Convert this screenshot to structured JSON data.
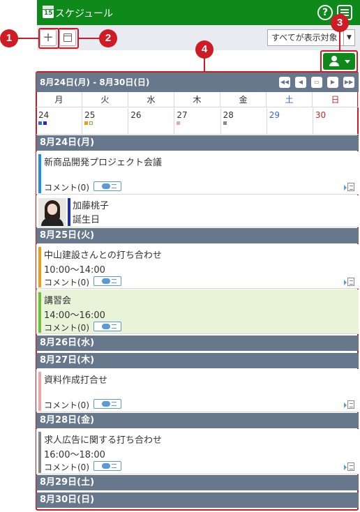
{
  "header": {
    "title": "スケジュール",
    "logo_number": "15",
    "help_label": "?"
  },
  "toolbar": {
    "add_label": "+",
    "filter_value": "すべてが表示対象",
    "filter_arrow": "▼"
  },
  "markers": [
    "1",
    "2",
    "3",
    "4"
  ],
  "calendar": {
    "range": "8月24日(月) - 8月30日(日)",
    "weekdays": [
      "月",
      "火",
      "水",
      "木",
      "金",
      "土",
      "日"
    ],
    "dates": [
      "24",
      "25",
      "26",
      "27",
      "28",
      "29",
      "30"
    ],
    "date_colors": [
      "#333333",
      "#333333",
      "#333333",
      "#333333",
      "#333333",
      "#3c63c8",
      "#c8282a"
    ],
    "day_dots": [
      [
        "#2a6edb",
        "#1a2fb5"
      ],
      [
        "#f39c12",
        "outline"
      ],
      [],
      [
        "#f4a3a3"
      ],
      [
        "#888888"
      ],
      [],
      []
    ]
  },
  "days": [
    {
      "header": "8月24日(月)"
    },
    {
      "header": "8月25日(火)"
    },
    {
      "header": "8月26日(水)"
    },
    {
      "header": "8月27日(木)"
    },
    {
      "header": "8月28日(金)"
    },
    {
      "header": "8月29日(土)"
    },
    {
      "header": "8月30日(日)"
    }
  ],
  "events": [
    {
      "title": "新商品開発プロジェクト会議",
      "time": "",
      "comment": "コメント(0)",
      "color": "#1e90e0"
    },
    {
      "title": "中山建設さんとの打ち合わせ",
      "time": "10:00～14:00",
      "comment": "コメント(0)",
      "color": "#f39c12"
    },
    {
      "title": "講習会",
      "time": "14:00～16:00",
      "comment": "コメント(0)",
      "color": "#6dbf3f"
    },
    {
      "title": "資料作成打合せ",
      "time": "",
      "comment": "コメント(0)",
      "color": "#f4a3a3"
    },
    {
      "title": "求人広告に関する打ち合わせ",
      "time": "16:00～18:00",
      "comment": "コメント(0)",
      "color": "#888888"
    }
  ],
  "birthday": {
    "name": "加藤桃子",
    "label": "誕生日",
    "color": "#1a2fb5"
  }
}
